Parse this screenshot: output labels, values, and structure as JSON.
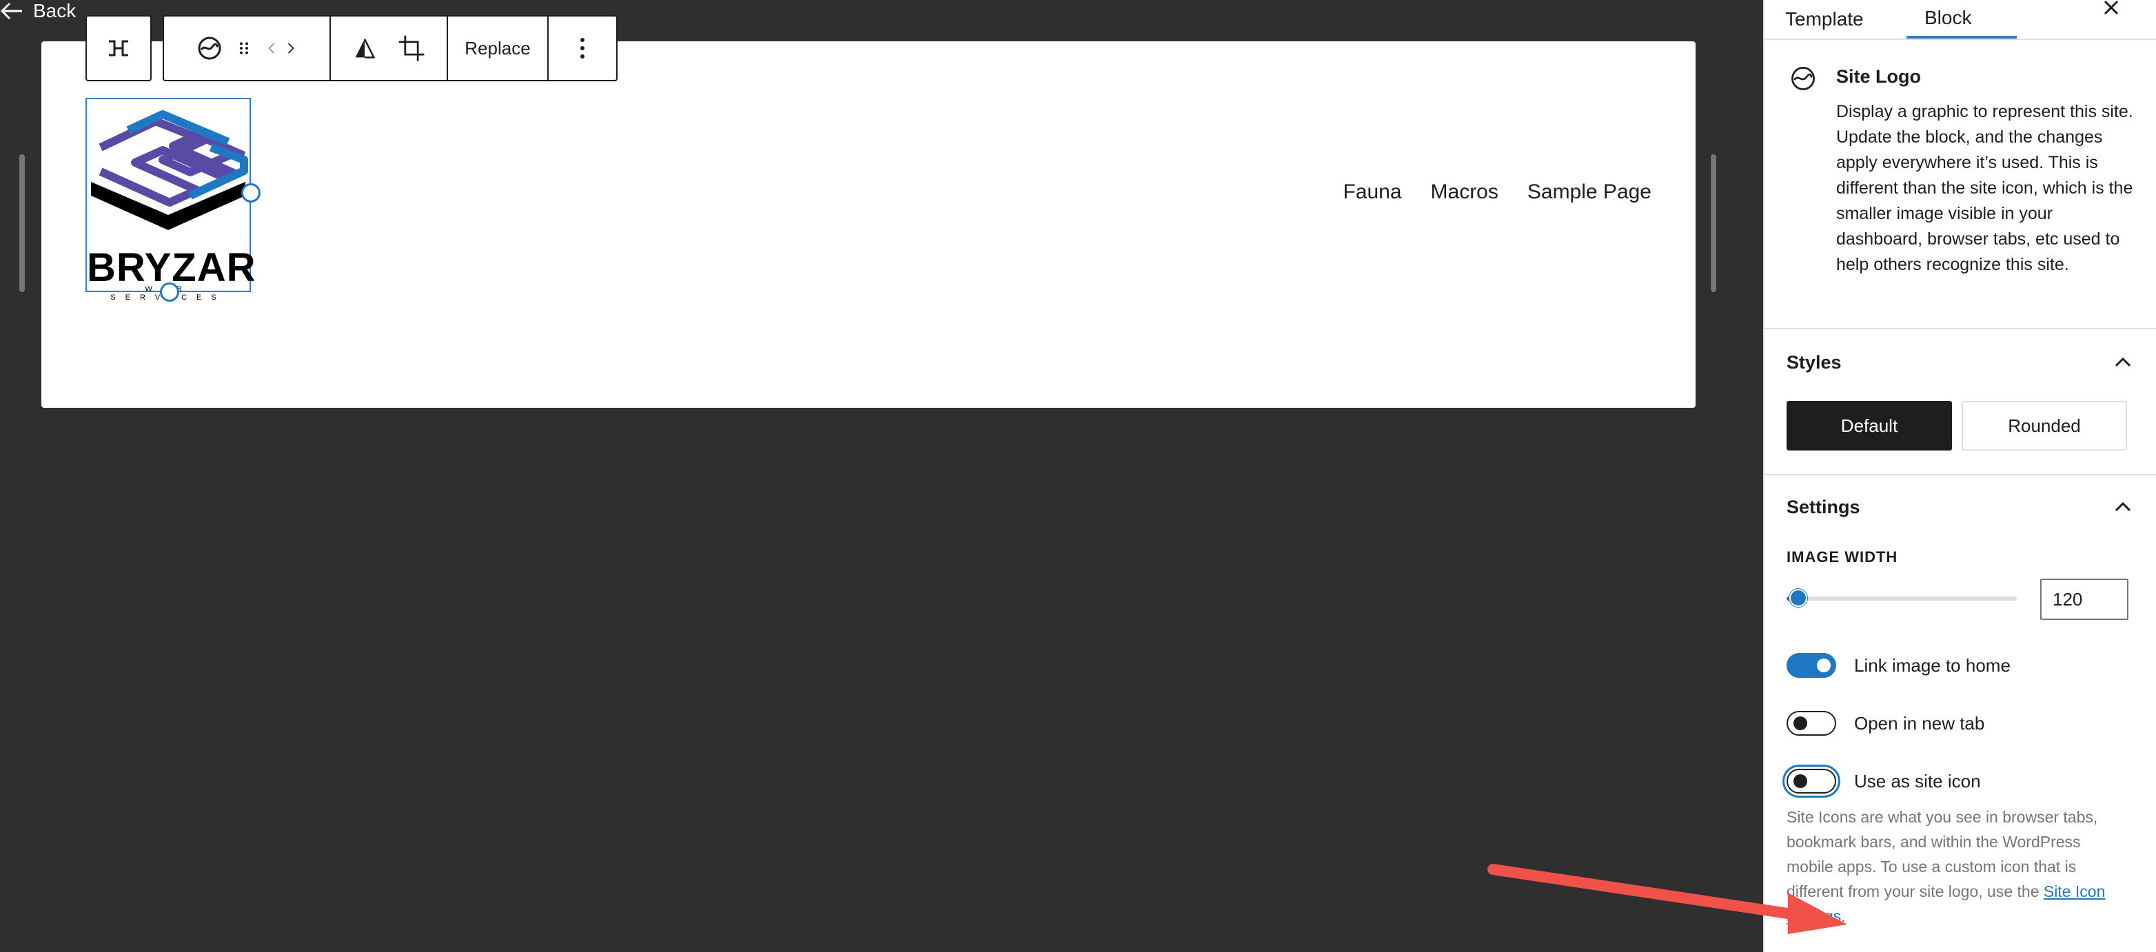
{
  "header": {
    "back_label": "Back"
  },
  "toolbar": {
    "replace_label": "Replace"
  },
  "logo": {
    "wordmark": "BRYZAR",
    "tagline": "WEB SERVICES",
    "colors": {
      "purple": "#5a4aa6",
      "blue": "#1e78c2",
      "black": "#000000"
    }
  },
  "nav": {
    "items": [
      "Fauna",
      "Macros",
      "Sample Page"
    ]
  },
  "sidebar": {
    "tabs": [
      {
        "label": "Template"
      },
      {
        "label": "Block"
      }
    ],
    "block": {
      "title": "Site Logo",
      "description": "Display a graphic to represent this site. Update the block, and the changes apply everywhere it’s used. This is different than the site icon, which is the smaller image visible in your dashboard, browser tabs, etc used to help others recognize this site."
    },
    "styles": {
      "heading": "Styles",
      "options": [
        {
          "label": "Default",
          "selected": true
        },
        {
          "label": "Rounded",
          "selected": false
        }
      ]
    },
    "settings": {
      "heading": "Settings",
      "image_width_label": "IMAGE WIDTH",
      "image_width_value": "120",
      "image_width_fraction": 0.05,
      "toggles": [
        {
          "label": "Link image to home",
          "on": true
        },
        {
          "label": "Open in new tab",
          "on": false
        },
        {
          "label": "Use as site icon",
          "on": false
        }
      ],
      "help_text": "Site Icons are what you see in browser tabs, bookmark bars, and within the WordPress mobile apps. To use a custom icon that is different from your site logo, use the",
      "help_link": "Site Icon settings",
      "help_end": "."
    }
  },
  "colors": {
    "accent": "#1e78c2",
    "annotation_arrow": "#f0524a",
    "canvas_bg": "#2f2f2f"
  }
}
